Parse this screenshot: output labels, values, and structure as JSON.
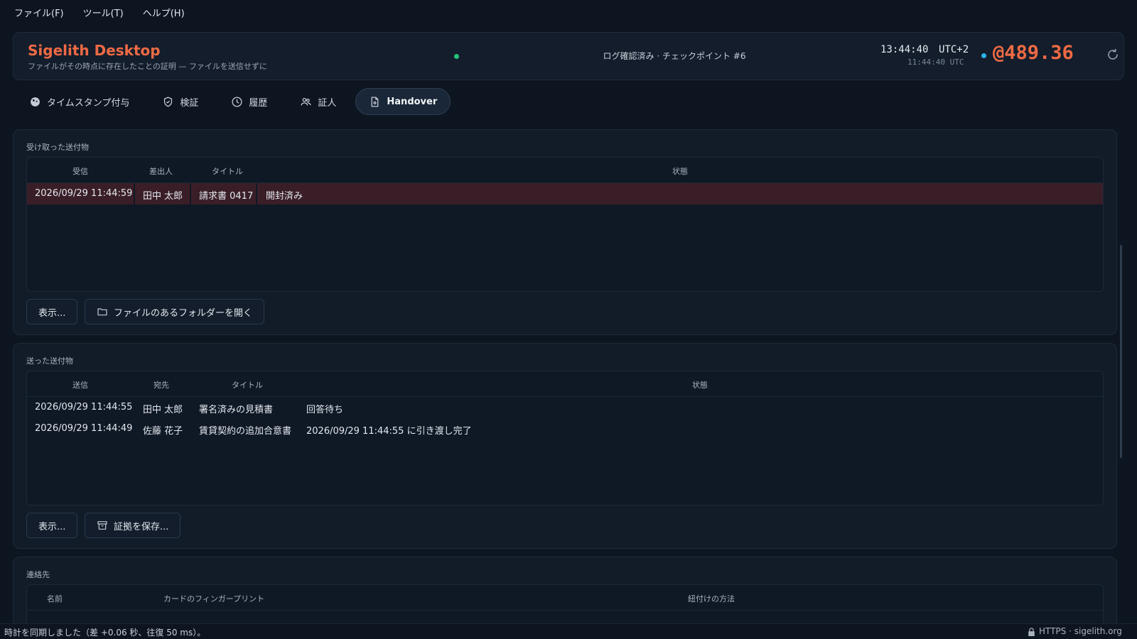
{
  "menu": {
    "file": "ファイル(F)",
    "tools": "ツール(T)",
    "help": "ヘルプ(H)"
  },
  "header": {
    "title": "Sigelith Desktop",
    "subtitle": "ファイルがその時点に存在したことの証明 — ファイルを送信せずに",
    "log_status": "ログ確認済み · チェックポイント #6",
    "clock_local": "13:44:40",
    "clock_zone": "UTC+2",
    "clock_utc": "11:44:40 UTC",
    "balance": "@489.36",
    "status_color": "#23c37a",
    "accent_color": "#ee6a44"
  },
  "tabs": [
    {
      "label": "タイムスタンプ付与",
      "icon": "stamp-icon"
    },
    {
      "label": "検証",
      "icon": "shield-check-icon"
    },
    {
      "label": "履歴",
      "icon": "clock-icon"
    },
    {
      "label": "証人",
      "icon": "people-icon"
    },
    {
      "label": "Handover",
      "icon": "document-icon",
      "active": true
    }
  ],
  "received": {
    "title": "受け取った送付物",
    "columns": [
      "受信",
      "差出人",
      "タイトル",
      "状態"
    ],
    "rows": [
      {
        "received": "2026/09/29 11:44:59",
        "sender": "田中 太郎",
        "title": "請求書 0417",
        "status": "開封済み",
        "selected": true
      }
    ],
    "view_button": "表示...",
    "open_folder_button": "ファイルのあるフォルダーを開く"
  },
  "sent": {
    "title": "送った送付物",
    "columns": [
      "送信",
      "宛先",
      "タイトル",
      "状態"
    ],
    "rows": [
      {
        "sent": "2026/09/29 11:44:55",
        "recipient": "田中 太郎",
        "title": "署名済みの見積書",
        "status": "回答待ち"
      },
      {
        "sent": "2026/09/29 11:44:49",
        "recipient": "佐藤 花子",
        "title": "賃貸契約の追加合意書",
        "status": "2026/09/29 11:44:55 に引き渡し完了"
      }
    ],
    "view_button": "表示...",
    "save_proof_button": "証拠を保存..."
  },
  "contacts": {
    "title": "連絡先",
    "columns": [
      "名前",
      "カードのフィンガープリント",
      "紐付けの方法"
    ]
  },
  "statusbar": {
    "message": "時計を同期しました（差 +0.06 秒、往復 50 ms）。",
    "connection": "HTTPS · sigelith.org"
  }
}
